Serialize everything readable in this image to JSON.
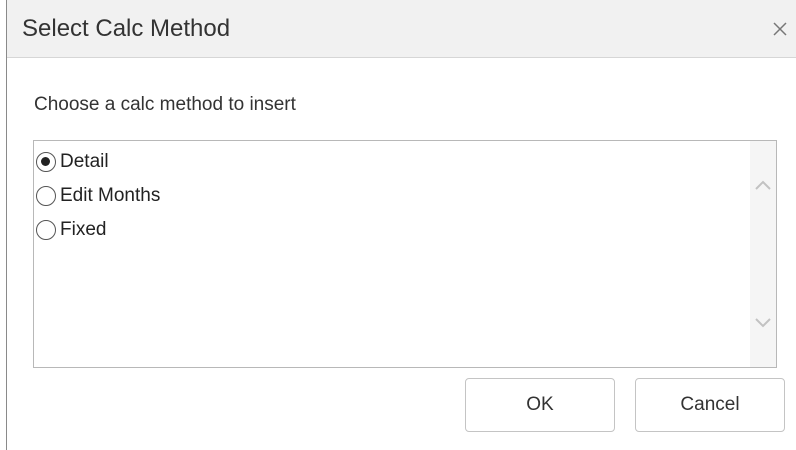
{
  "dialog": {
    "title": "Select Calc Method",
    "close_icon": "close-icon",
    "prompt": "Choose a calc method to insert",
    "options": [
      {
        "label": "Detail",
        "selected": true
      },
      {
        "label": "Edit Months",
        "selected": false
      },
      {
        "label": "Fixed",
        "selected": false
      }
    ],
    "scroll_up_icon": "chevron-up-icon",
    "scroll_down_icon": "chevron-down-icon",
    "ok_label": "OK",
    "cancel_label": "Cancel"
  }
}
